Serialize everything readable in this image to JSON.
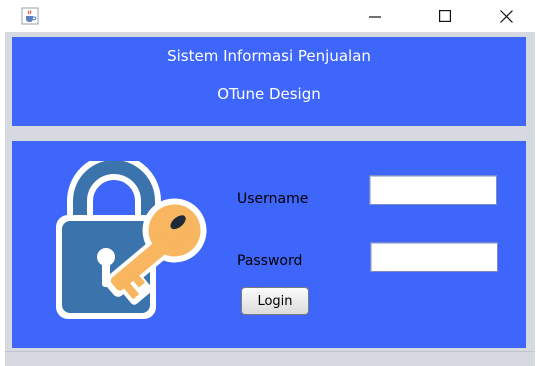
{
  "window": {
    "title": "",
    "controls": {
      "minimize": "–",
      "maximize": "☐",
      "close": "✕"
    }
  },
  "header": {
    "line1": "Sistem Informasi Penjualan",
    "line2": "OTune Design"
  },
  "form": {
    "username_label": "Username",
    "password_label": "Password",
    "username_value": "",
    "password_value": "",
    "login_label": "Login"
  },
  "colors": {
    "panel_blue": "#3e66fb",
    "background_gray": "#d6d9df",
    "lock_blue": "#3b73ac",
    "key_orange": "#f7b65f"
  },
  "icons": {
    "app": "java-coffee-icon",
    "illustration": "lock-and-key-icon"
  }
}
